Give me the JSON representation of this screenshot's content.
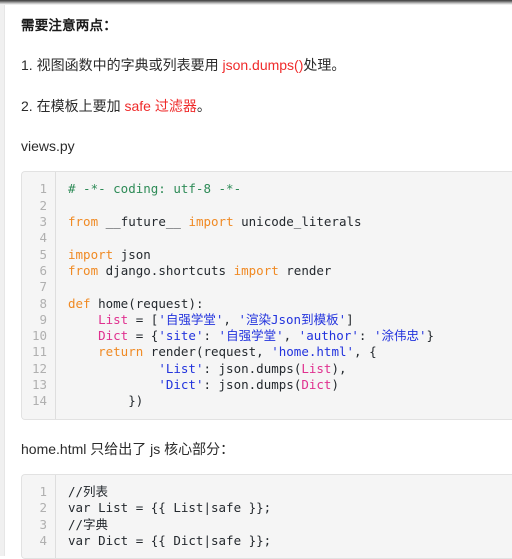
{
  "document": {
    "notice_title": "需要注意两点：",
    "points": [
      {
        "prefix": "1. 视图函数中的字典或列表要用 ",
        "highlight": "json.dumps()",
        "suffix": "处理。"
      },
      {
        "prefix": "2. 在模板上要加 ",
        "highlight": "safe 过滤器",
        "suffix": "。"
      }
    ],
    "file_label_1": "views.py",
    "file_label_2": "home.html 只给出了 js 核心部分："
  },
  "colors": {
    "highlight_red": "#ef2b2b",
    "comment_green": "#2e8b57",
    "keyword_orange": "#f08a24",
    "string_blue": "#2233dd",
    "variable_pink": "#e0308f",
    "code_background": "#f5f5f5",
    "gutter_text": "#b0b0b0"
  },
  "code_block_1": {
    "language": "python",
    "line_numbers": [
      "1",
      "2",
      "3",
      "4",
      "5",
      "6",
      "7",
      "8",
      "9",
      "10",
      "11",
      "12",
      "13",
      "14"
    ],
    "lines": [
      "# -*- coding: utf-8 -*-",
      "",
      "from __future__ import unicode_literals",
      "",
      "import json",
      "from django.shortcuts import render",
      "",
      "def home(request):",
      "    List = ['自强学堂', '渲染Json到模板']",
      "    Dict = {'site': '自强学堂', 'author': '涂伟忠'}",
      "    return render(request, 'home.html', {",
      "            'List': json.dumps(List),",
      "            'Dict': json.dumps(Dict)",
      "        })"
    ]
  },
  "code_block_2": {
    "language": "html",
    "line_numbers": [
      "1",
      "2",
      "3",
      "4"
    ],
    "lines": [
      "//列表",
      "var List = {{ List|safe }};",
      "//字典",
      "var Dict = {{ Dict|safe }};"
    ]
  }
}
